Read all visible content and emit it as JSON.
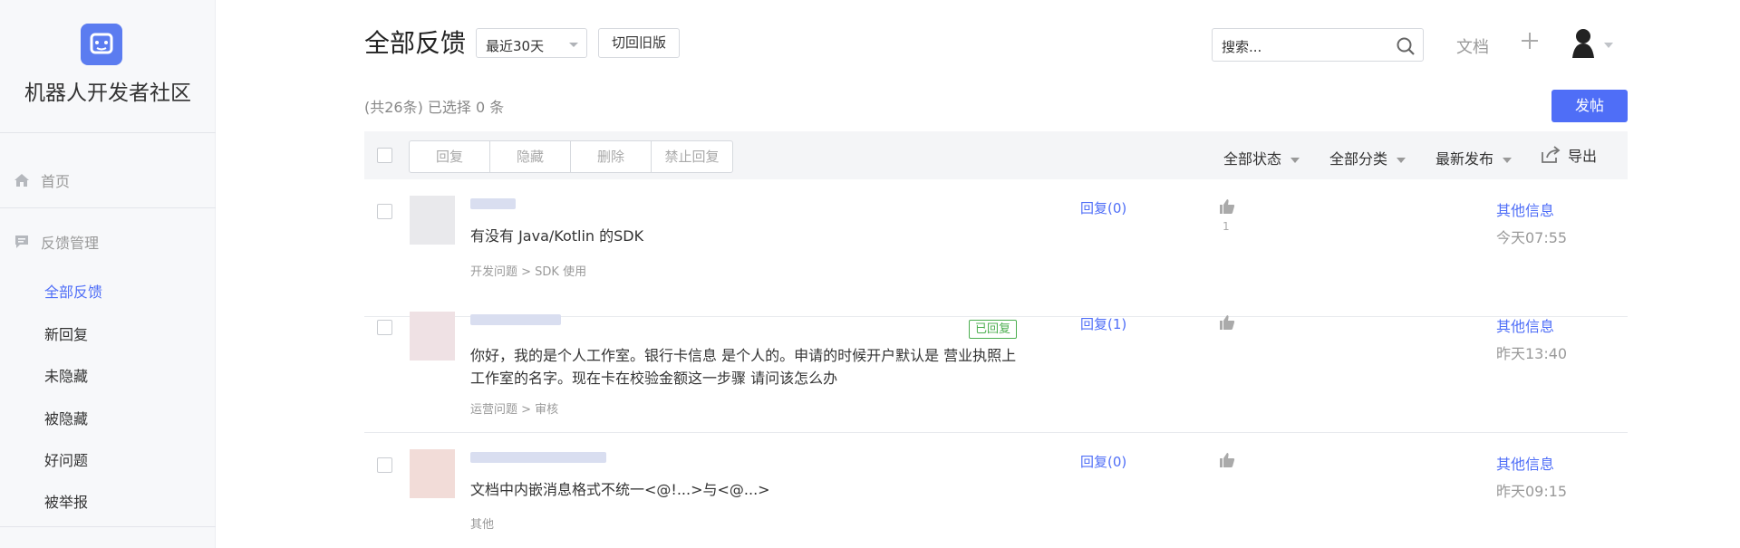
{
  "sidebar": {
    "site_name": "机器人开发者社区",
    "home": "首页",
    "feedback_section": "反馈管理",
    "items": [
      {
        "label": "全部反馈"
      },
      {
        "label": "新回复"
      },
      {
        "label": "未隐藏"
      },
      {
        "label": "被隐藏"
      },
      {
        "label": "好问题"
      },
      {
        "label": "被举报"
      }
    ],
    "active_item": "全部反馈"
  },
  "header": {
    "title": "全部反馈",
    "date_filter": "最近30天",
    "switch_old": "切回旧版",
    "search_placeholder": "搜索...",
    "docs": "文档"
  },
  "summary": {
    "count_text": "(共26条) 已选择 0 条",
    "post_button": "发帖"
  },
  "toolbar": {
    "bulk_actions": [
      "回复",
      "隐藏",
      "删除",
      "禁止回复"
    ],
    "status_filter": "全部状态",
    "category_filter": "全部分类",
    "sort_filter": "最新发布",
    "export": "导出"
  },
  "posts": [
    {
      "content": "有没有 Java/Kotlin 的SDK",
      "category": "开发问题 > SDK 使用",
      "reply": "回复(0)",
      "likes": "1",
      "more": "其他信息",
      "time": "今天07:55"
    },
    {
      "badge": "已回复",
      "content": "你好，我的是个人工作室。银行卡信息 是个人的。申请的时候开户默认是 营业执照上工作室的名字。现在卡在校验金额这一步骤 请问该怎么办",
      "category": "运营问题 > 审核",
      "reply": "回复(1)",
      "more": "其他信息",
      "time": "昨天13:40"
    },
    {
      "content": "文档中内嵌消息格式不统一<@!...>与<@...>",
      "category": "其他",
      "reply": "回复(0)",
      "more": "其他信息",
      "time": "昨天09:15"
    }
  ],
  "colors": {
    "accent": "#4f6ef7",
    "badge_green": "#4caf50",
    "muted": "#999999"
  }
}
